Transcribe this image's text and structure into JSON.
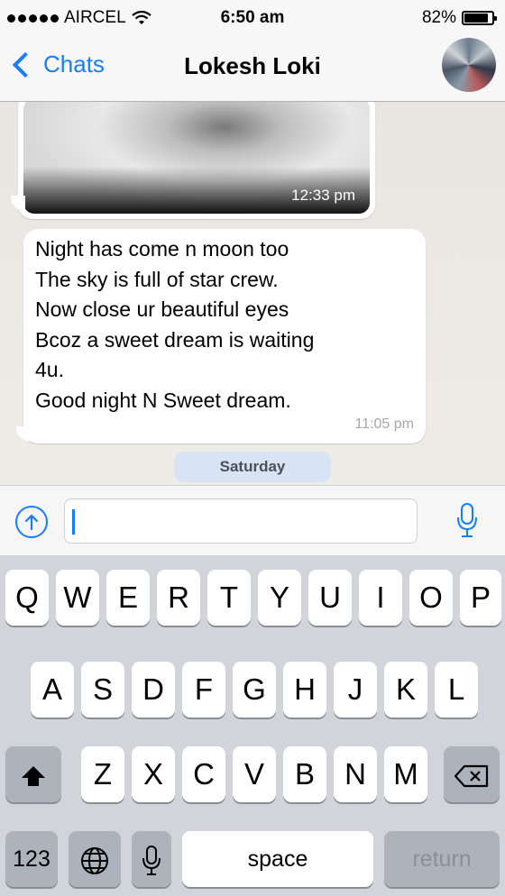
{
  "status_bar": {
    "carrier": "AIRCEL",
    "time": "6:50 am",
    "battery": "82%",
    "battery_level": 0.82
  },
  "nav": {
    "back_label": "Chats",
    "title": "Lokesh Loki"
  },
  "messages": {
    "image_time": "12:33 pm",
    "text": "Night has come n moon too\nThe sky is full of star crew.\nNow close ur beautiful eyes\nBcoz a sweet dream is waiting\n4u.\nGood night N Sweet dream.",
    "text_time": "11:05 pm",
    "day_separator": "Saturday"
  },
  "input": {
    "value": ""
  },
  "keyboard": {
    "row1": [
      "Q",
      "W",
      "E",
      "R",
      "T",
      "Y",
      "U",
      "I",
      "O",
      "P"
    ],
    "row2": [
      "A",
      "S",
      "D",
      "F",
      "G",
      "H",
      "J",
      "K",
      "L"
    ],
    "row3": [
      "Z",
      "X",
      "C",
      "V",
      "B",
      "N",
      "M"
    ],
    "numbers_label": "123",
    "space_label": "space",
    "return_label": "return"
  },
  "colors": {
    "accent": "#157efb",
    "day_pill": "#d8e3f3",
    "keyboard_bg": "#d1d5db"
  }
}
